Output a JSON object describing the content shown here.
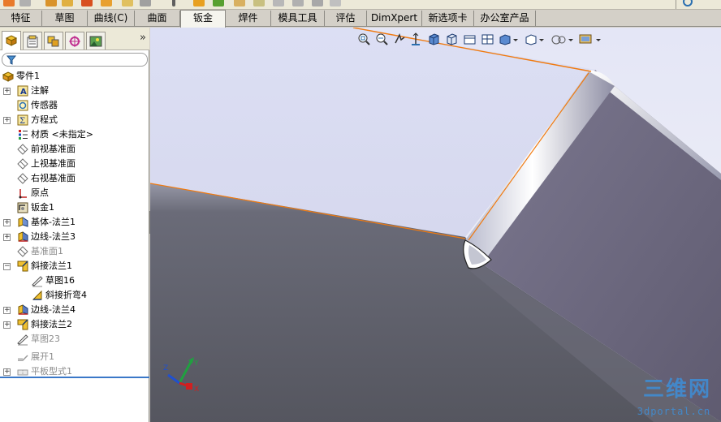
{
  "tabs": [
    "特征",
    "草图",
    "曲线(C)",
    "曲面",
    "钣金",
    "焊件",
    "模具工具",
    "评估",
    "DimXpert",
    "新选项卡",
    "办公室产品"
  ],
  "active_tab": "钣金",
  "panel_tabs": [
    "feature-manager-icon",
    "property-manager-icon",
    "configuration-manager-icon",
    "dimxpert-manager-icon",
    "display-manager-icon"
  ],
  "panel_expand": "»",
  "tree": [
    {
      "label": "零件1",
      "icon": "part-icon",
      "expand": "",
      "indent": 0
    },
    {
      "label": "注解",
      "icon": "annotation-icon",
      "expand": "+",
      "indent": 1
    },
    {
      "label": "传感器",
      "icon": "sensor-icon",
      "expand": "",
      "indent": 1
    },
    {
      "label": "方程式",
      "icon": "equation-icon",
      "expand": "+",
      "indent": 1
    },
    {
      "label": "材质 <未指定>",
      "icon": "material-icon",
      "expand": "",
      "indent": 1
    },
    {
      "label": "前视基准面",
      "icon": "plane-icon",
      "expand": "",
      "indent": 1
    },
    {
      "label": "上视基准面",
      "icon": "plane-icon",
      "expand": "",
      "indent": 1
    },
    {
      "label": "右视基准面",
      "icon": "plane-icon",
      "expand": "",
      "indent": 1
    },
    {
      "label": "原点",
      "icon": "origin-icon",
      "expand": "",
      "indent": 1
    },
    {
      "label": "钣金1",
      "icon": "sheet-metal-icon",
      "expand": "",
      "indent": 1
    },
    {
      "label": "基体-法兰1",
      "icon": "base-flange-icon",
      "expand": "+",
      "indent": 1
    },
    {
      "label": "边线-法兰3",
      "icon": "edge-flange-icon",
      "expand": "+",
      "indent": 1
    },
    {
      "label": "基准面1",
      "icon": "plane-icon",
      "expand": "",
      "indent": 1,
      "dim": true
    },
    {
      "label": "斜接法兰1",
      "icon": "miter-flange-icon",
      "expand": "-",
      "indent": 1
    },
    {
      "label": "草图16",
      "icon": "sketch-icon",
      "expand": "",
      "indent": 2
    },
    {
      "label": "斜接折弯4",
      "icon": "miter-bend-icon",
      "expand": "",
      "indent": 2
    },
    {
      "label": "边线-法兰4",
      "icon": "edge-flange-icon",
      "expand": "+",
      "indent": 1
    },
    {
      "label": "斜接法兰2",
      "icon": "miter-flange-icon",
      "expand": "+",
      "indent": 1
    },
    {
      "label": "草图23",
      "icon": "sketch-icon",
      "expand": "",
      "indent": 1,
      "dim": true
    },
    {
      "label": "展开1",
      "icon": "unfold-icon",
      "expand": "",
      "indent": 1,
      "dim": true
    },
    {
      "label": "平板型式1",
      "icon": "flat-pattern-icon",
      "expand": "+",
      "indent": 1,
      "dim": true
    }
  ],
  "view_tools": [
    "zoom-to-fit-icon",
    "zoom-to-area-icon",
    "previous-view-icon",
    "section-view-icon",
    "view-orientation-icon",
    "display-style-icon",
    "hide-show-icon",
    "edit-appearance-icon",
    "apply-scene-icon",
    "view-settings-icon",
    "more-tools-icon"
  ],
  "watermark": "三维网",
  "watermark_sub": "3dportal.cn",
  "triad": {
    "x": "X",
    "y": "Y",
    "z": "Z"
  },
  "colors": {
    "face_light": "#d9dcf3",
    "face_dark": "#5e6070",
    "face_right": "#6e6a7e",
    "edge_orange": "#f07a10",
    "accent_blue": "#3a78c8"
  }
}
